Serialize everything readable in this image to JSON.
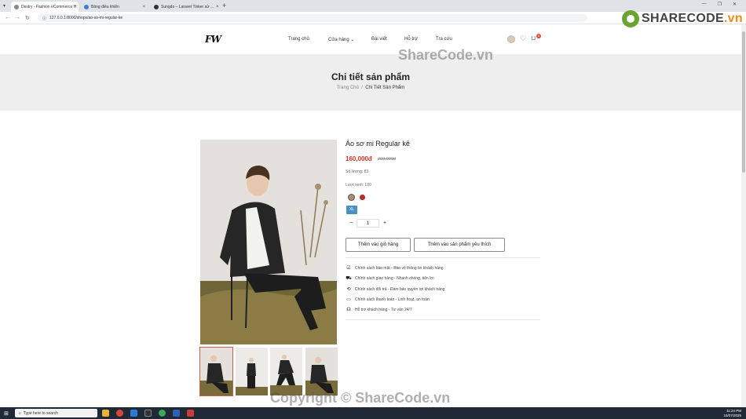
{
  "browser": {
    "tabs": [
      {
        "title": "Destry - Fashion eCommerce H",
        "active": true
      },
      {
        "title": "Bảng điều khiển",
        "active": false
      },
      {
        "title": "Sungdo – Laravel Tinker sử ...",
        "active": false
      }
    ],
    "url": "127.0.0.1:8000/shops/ao-so-mi-regular-ke"
  },
  "watermark": {
    "brand_main": "SHARECODE",
    "brand_suffix": ".vn",
    "center_text": "ShareCode.vn",
    "bottom_text": "Copyright © ShareCode.vn"
  },
  "header": {
    "logo": "FW",
    "nav": [
      "Trang chủ",
      "Cửa hàng",
      "Bài viết",
      "Hỗ trợ",
      "Tra cứu"
    ],
    "cart_count": "0"
  },
  "banner": {
    "title": "Chi tiết sản phẩm",
    "breadcrumb": [
      "Trang Chủ",
      "Chi Tiết Sản Phẩm"
    ]
  },
  "product": {
    "name": "Áo sơ mi Regular kẻ",
    "price": "160,000đ",
    "old_price": "200,000đ",
    "stock": "Số lượng: 83",
    "views": "Lượt xem: 130",
    "colors": [
      "#b08d6a",
      "#b2332b"
    ],
    "size": "XL",
    "quantity": "1",
    "qty_minus": "−",
    "qty_plus": "+",
    "add_to_cart": "Thêm vào giỏ hàng",
    "add_to_wishlist": "Thêm vào sản phẩm yêu thích",
    "policies": [
      {
        "icon": "check-square-icon",
        "text": "Chính sách bảo mật - Bảo vệ thông tin khách hàng"
      },
      {
        "icon": "truck-icon",
        "text": "Chính sách giao hàng - Nhanh chóng, tiện lợi"
      },
      {
        "icon": "refresh-icon",
        "text": "Chính sách đổi trả - Đảm bảo quyền lợi khách hàng"
      },
      {
        "icon": "credit-card-icon",
        "text": "Chính sách thanh toán - Linh hoạt, an toàn"
      },
      {
        "icon": "headset-icon",
        "text": "Hỗ trợ khách hàng - Tư vấn 24/7"
      }
    ]
  },
  "taskbar": {
    "search_placeholder": "Type here to search",
    "time": "11:24 PM",
    "date": "15/07/2025"
  }
}
